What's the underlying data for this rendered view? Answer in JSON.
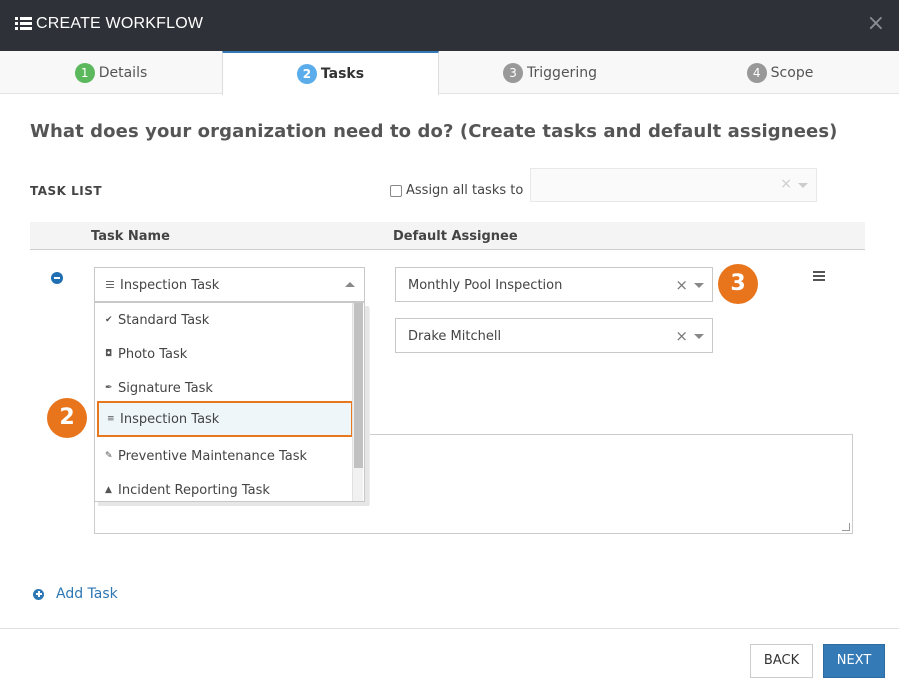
{
  "header": {
    "title": "CREATE WORKFLOW",
    "close": "×",
    "list_icon": "list-icon"
  },
  "tabs": [
    {
      "num": "1",
      "label": "Details",
      "color": "#5cb85c"
    },
    {
      "num": "2",
      "label": "Tasks",
      "color": "#5bacea"
    },
    {
      "num": "3",
      "label": "Triggering",
      "color": "#999999"
    },
    {
      "num": "4",
      "label": "Scope",
      "color": "#999999"
    }
  ],
  "heading": "What does your organization need to do? (Create tasks and default assignees)",
  "task_list_label": "TASK LIST",
  "assign_all_label": "Assign all tasks to",
  "columns": {
    "task_name": "Task Name",
    "default_assignee": "Default Assignee"
  },
  "task": {
    "selected": "Inspection Task"
  },
  "dropdown": [
    {
      "label": "Standard Task",
      "icon": "check-badge-icon",
      "glyph": "✔"
    },
    {
      "label": "Photo Task",
      "icon": "camera-icon",
      "glyph": "◘"
    },
    {
      "label": "Signature Task",
      "icon": "pen-icon",
      "glyph": "✒"
    },
    {
      "label": "Inspection Task",
      "icon": "lines-icon",
      "glyph": "≡"
    },
    {
      "label": "Preventive Maintenance Task",
      "icon": "wrench-icon",
      "glyph": "✎"
    },
    {
      "label": "Incident Reporting Task",
      "icon": "warning-icon",
      "glyph": "▲"
    }
  ],
  "assignees": [
    {
      "value": "Monthly Pool Inspection",
      "clear": "×"
    },
    {
      "value": "Drake Mitchell",
      "clear": "×"
    }
  ],
  "badges": {
    "two": "2",
    "three": "3",
    "color": "#e8741c"
  },
  "add_task": "Add Task",
  "buttons": {
    "back": "BACK",
    "next": "NEXT"
  },
  "colors": {
    "accent": "#337ab7",
    "header_bg": "#2e3137"
  }
}
